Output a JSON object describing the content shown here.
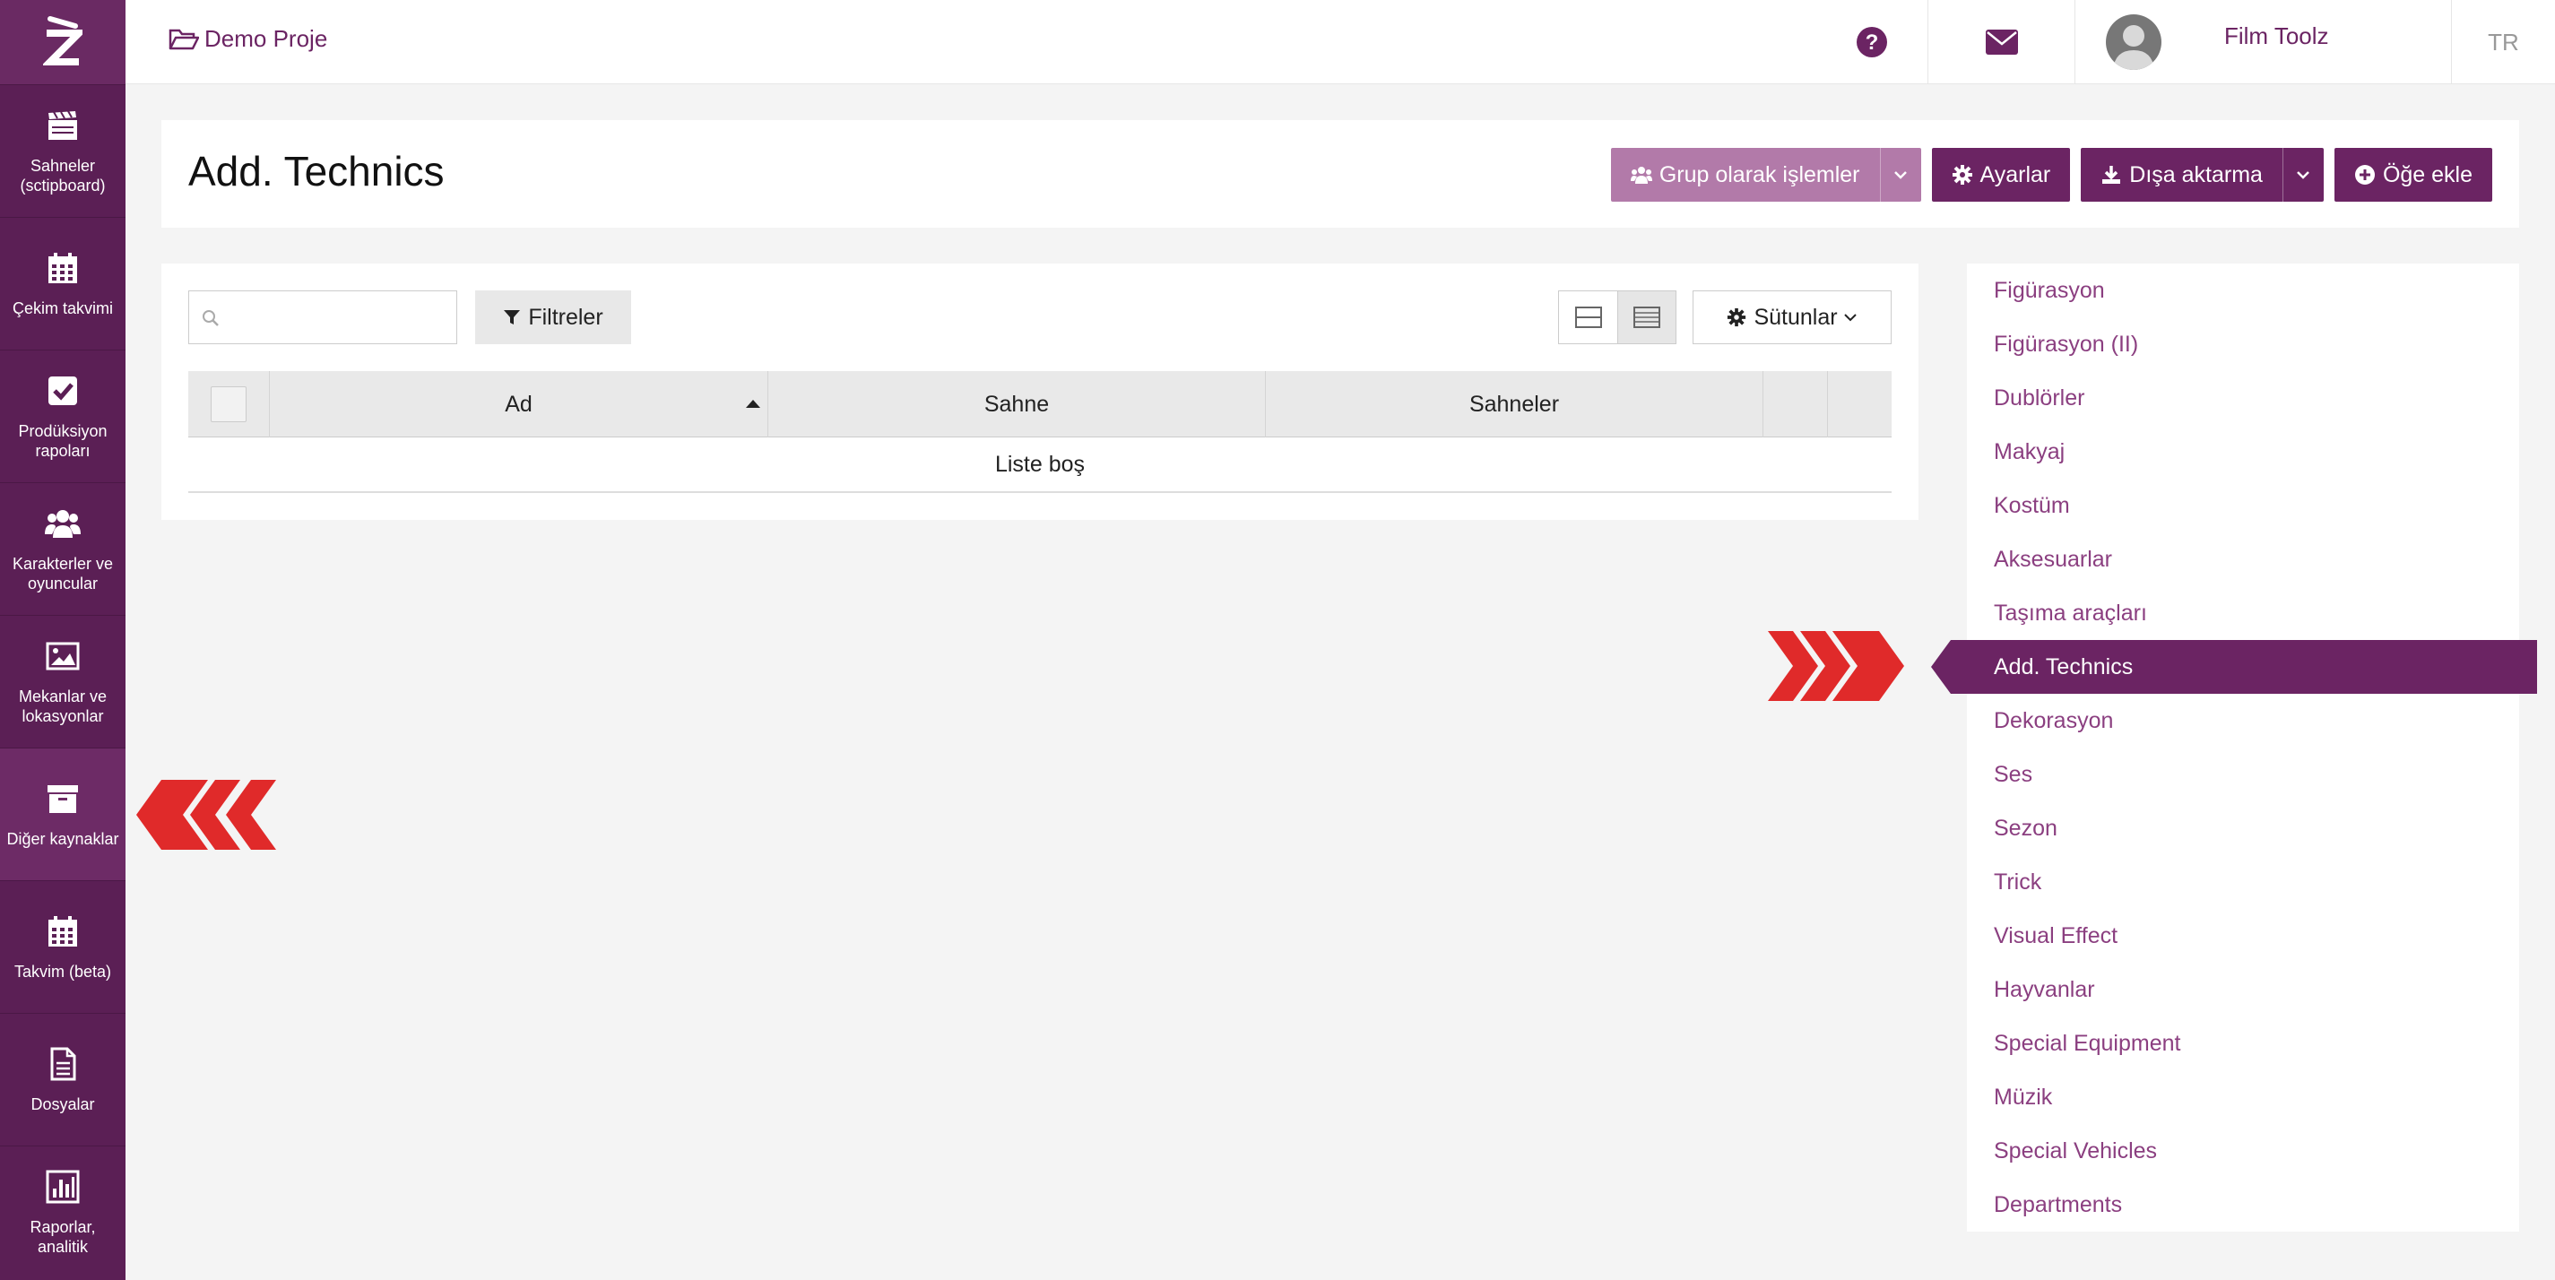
{
  "app": {
    "logo_letter": "Z",
    "brand_color": "#6b2463"
  },
  "sidebar": {
    "items": [
      {
        "label_line1": "Sahneler",
        "label_line2": "(sctipboard)",
        "icon": "clapperboard-icon"
      },
      {
        "label_line1": "Çekim takvimi",
        "label_line2": "",
        "icon": "calendar-icon"
      },
      {
        "label_line1": "Prodüksiyon",
        "label_line2": "rapoları",
        "icon": "checkbox-icon"
      },
      {
        "label_line1": "Karakterler ve",
        "label_line2": "oyuncular",
        "icon": "users-icon"
      },
      {
        "label_line1": "Mekanlar ve",
        "label_line2": "lokasyonlar",
        "icon": "image-icon"
      },
      {
        "label_line1": "Diğer kaynaklar",
        "label_line2": "",
        "icon": "archive-icon"
      },
      {
        "label_line1": "Takvim (beta)",
        "label_line2": "",
        "icon": "calendar-icon"
      },
      {
        "label_line1": "Dosyalar",
        "label_line2": "",
        "icon": "file-icon"
      },
      {
        "label_line1": "Raporlar, analitik",
        "label_line2": "",
        "icon": "bar-chart-icon"
      }
    ]
  },
  "topbar": {
    "project_name": "Demo Proje",
    "user_name": "Film Toolz",
    "language": "TR"
  },
  "header": {
    "title": "Add. Technics",
    "buttons": {
      "group_actions": "Grup olarak işlemler",
      "settings": "Ayarlar",
      "export": "Dışa aktarma",
      "add_item": "Öğe ekle"
    }
  },
  "table": {
    "search_placeholder": "",
    "filters_label": "Filtreler",
    "columns_label": "Sütunlar",
    "headers": [
      "Ad",
      "Sahne",
      "Sahneler"
    ],
    "empty_text": "Liste boş"
  },
  "categories": {
    "items": [
      "Figürasyon",
      "Figürasyon (II)",
      "Dublörler",
      "Makyaj",
      "Kostüm",
      "Aksesuarlar",
      "Taşıma araçları",
      "Add. Technics",
      "Dekorasyon",
      "Ses",
      "Sezon",
      "Trick",
      "Visual Effect",
      "Hayvanlar",
      "Special Equipment",
      "Müzik",
      "Special Vehicles",
      "Departments"
    ],
    "active": "Add. Technics"
  }
}
